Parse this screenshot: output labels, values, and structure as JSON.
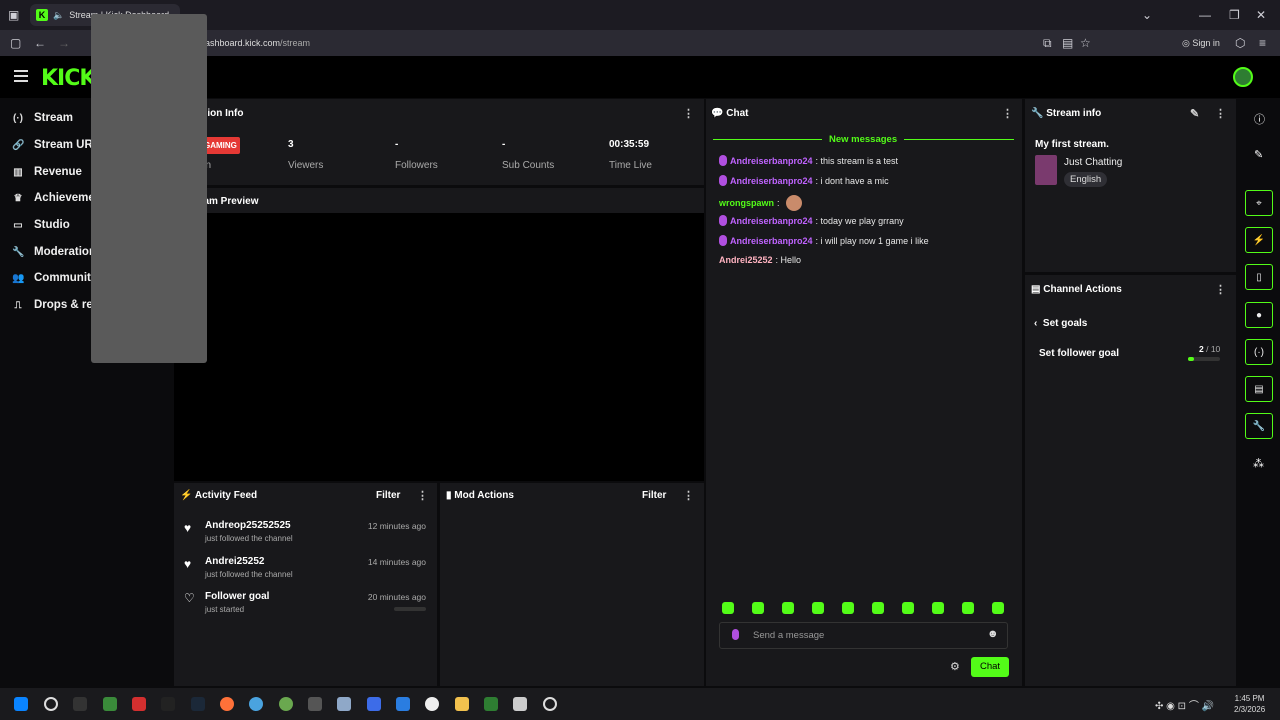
{
  "browser": {
    "tab_title": "Stream | Kick Dashboard",
    "url_host": "dashboard.kick.com",
    "url_path": "/stream",
    "sign_in": "Sign in"
  },
  "app": {
    "logo": "KICK"
  },
  "sidebar": {
    "items": [
      {
        "label": "Stream",
        "icon": "stream-icon"
      },
      {
        "label": "Stream URL",
        "icon": "link-icon"
      },
      {
        "label": "Revenue",
        "icon": "chart-icon"
      },
      {
        "label": "Achievements",
        "icon": "trophy-icon"
      },
      {
        "label": "Studio",
        "icon": "monitor-icon"
      },
      {
        "label": "Moderation",
        "icon": "wrench-icon"
      },
      {
        "label": "Community",
        "icon": "people-icon"
      },
      {
        "label": "Drops & rewards",
        "icon": "drops-icon"
      }
    ]
  },
  "session": {
    "title": "Session Info",
    "badge": "GAMING",
    "badge_label": "on",
    "stats": [
      {
        "value": "3",
        "label": "Viewers"
      },
      {
        "value": "-",
        "label": "Followers"
      },
      {
        "value": "-",
        "label": "Sub Counts"
      },
      {
        "value": "00:35:59",
        "label": "Time Live"
      }
    ]
  },
  "preview": {
    "title": "Stream Preview"
  },
  "chat": {
    "title": "Chat",
    "new_messages": "New messages",
    "messages": [
      {
        "user": "Andreiserbanpro24",
        "text": ": this stream is a test"
      },
      {
        "user": "Andreiserbanpro24",
        "text": ": i dont have a mic"
      },
      {
        "user": "wrongspawn",
        "text": ":"
      },
      {
        "user": "Andreiserbanpro24",
        "text": ": today we play grrany"
      },
      {
        "user": "Andreiserbanpro24",
        "text": ": i will play now 1 game i like"
      },
      {
        "user": "Andrei25252",
        "text": ": Hello"
      }
    ],
    "input_placeholder": "Send a message",
    "send_button": "Chat"
  },
  "stream_info": {
    "title": "Stream info",
    "stream_title": "My first stream.",
    "category": "Just Chatting",
    "language": "English"
  },
  "channel_actions": {
    "title": "Channel Actions",
    "back_label": "Set goals",
    "goal_label": "Set follower goal",
    "goal_current": "2",
    "goal_total": "/ 10",
    "goal_fraction": 0.2
  },
  "activity_feed": {
    "title": "Activity Feed",
    "filter": "Filter",
    "items": [
      {
        "name": "Andreop25252525",
        "sub": "just followed the channel",
        "time": "12 minutes ago"
      },
      {
        "name": "Andrei25252",
        "sub": "just followed the channel",
        "time": "14 minutes ago"
      },
      {
        "name": "Follower goal",
        "sub": "just started",
        "time": "20 minutes ago"
      }
    ]
  },
  "mod_actions": {
    "title": "Mod Actions",
    "filter": "Filter"
  },
  "taskbar": {
    "time": "1:45 PM",
    "date": "2/3/2026"
  },
  "colors": {
    "accent": "#53fc18",
    "panel": "#18181b",
    "live": "#e53935"
  }
}
